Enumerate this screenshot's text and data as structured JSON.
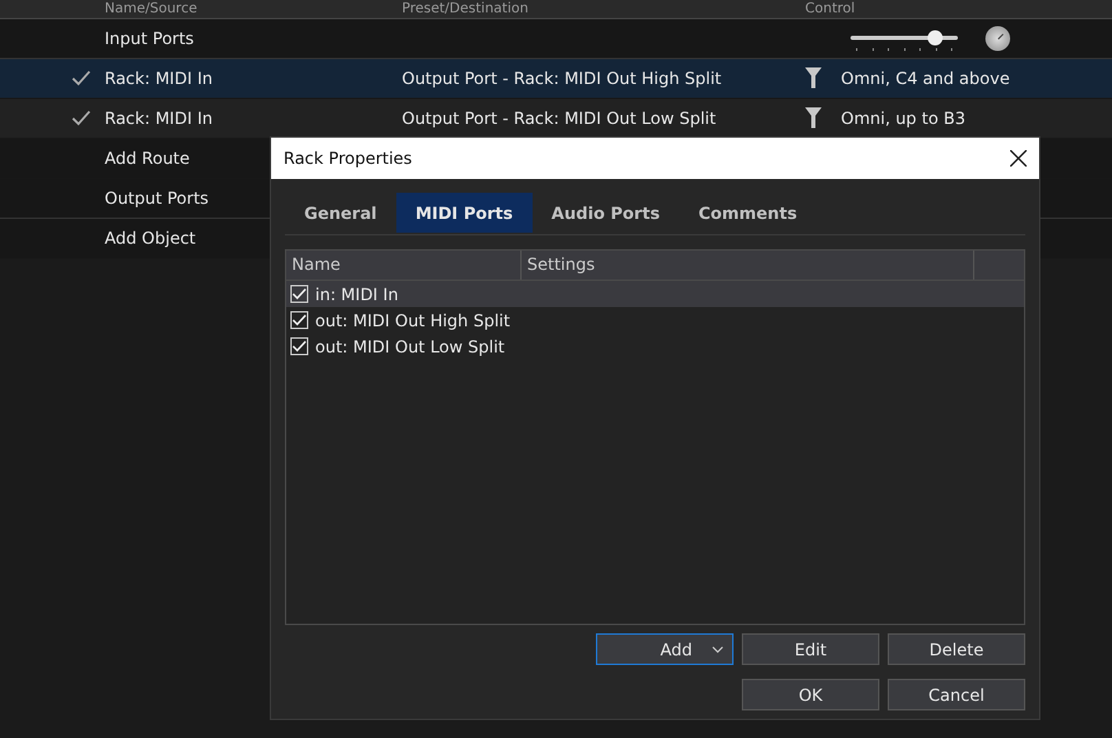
{
  "columns": [
    "Name/Source",
    "Preset/Destination",
    "Control"
  ],
  "rows": [
    {
      "kind": "group",
      "name": "Input Ports",
      "slider": {
        "level": 0.8
      }
    },
    {
      "kind": "route",
      "checked": true,
      "selected": true,
      "name": "Rack: MIDI In",
      "destination": "Output Port - Rack: MIDI Out High Split",
      "control": "Omni, C4 and above"
    },
    {
      "kind": "route",
      "checked": true,
      "selected": false,
      "name": "Rack: MIDI In",
      "destination": "Output Port - Rack: MIDI Out Low Split",
      "control": "Omni, up to B3"
    },
    {
      "kind": "add",
      "name": "Add Route"
    },
    {
      "kind": "group",
      "name": "Output Ports"
    },
    {
      "kind": "add",
      "name": "Add Object"
    }
  ],
  "dialog": {
    "title": "Rack Properties",
    "tabs": [
      {
        "label": "General",
        "selected": false
      },
      {
        "label": "MIDI Ports",
        "selected": true
      },
      {
        "label": "Audio Ports",
        "selected": false
      },
      {
        "label": "Comments",
        "selected": false
      }
    ],
    "table": {
      "columns": [
        "Name",
        "Settings"
      ],
      "rows": [
        {
          "name": "in: MIDI In",
          "checked": true,
          "selected": true
        },
        {
          "name": "out: MIDI Out High Split",
          "checked": true,
          "selected": false
        },
        {
          "name": "out: MIDI Out Low Split",
          "checked": true,
          "selected": false
        }
      ]
    },
    "list_buttons": [
      {
        "label": "Add",
        "kind": "dropdown"
      },
      {
        "label": "Edit",
        "kind": "plain"
      },
      {
        "label": "Delete",
        "kind": "plain"
      }
    ],
    "buttons": [
      "OK",
      "Cancel"
    ]
  }
}
